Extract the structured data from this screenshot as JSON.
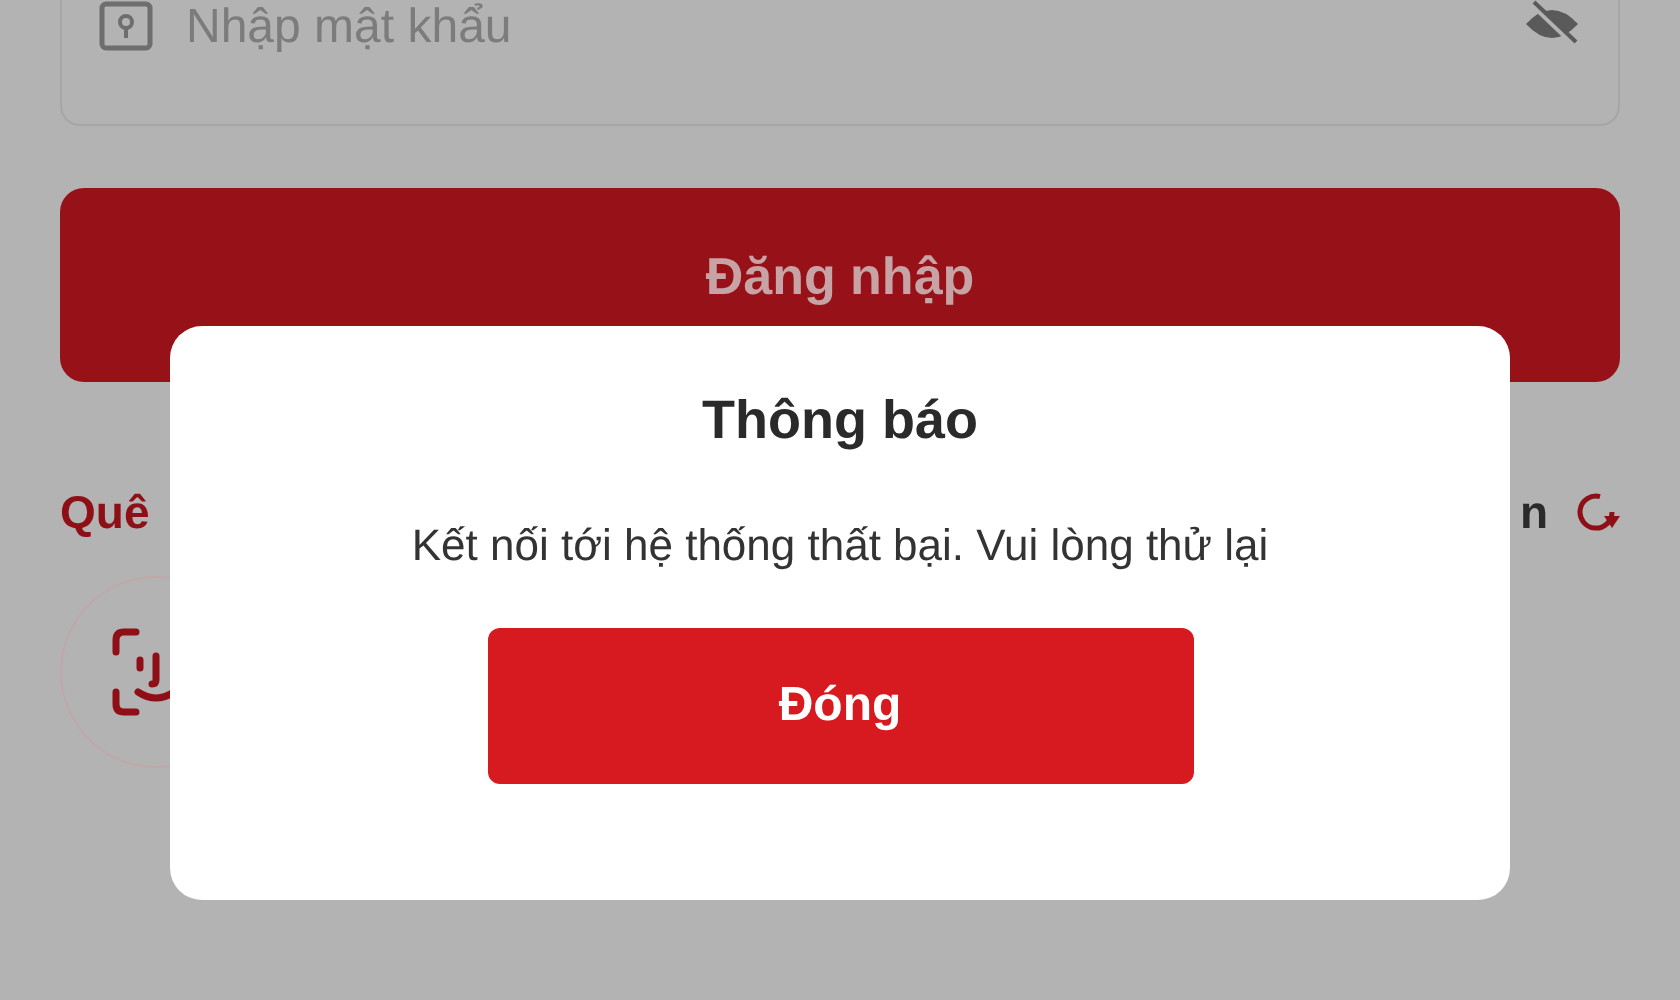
{
  "password_field": {
    "placeholder": "Nhập mật khẩu"
  },
  "login_button": {
    "label": "Đăng nhập"
  },
  "forgot_link": {
    "label": "Quê"
  },
  "switch_link": {
    "label": "n"
  },
  "dialog": {
    "title": "Thông báo",
    "message": "Kết nối tới hệ thống thất bại. Vui lòng thử lại",
    "button": "Đóng"
  }
}
